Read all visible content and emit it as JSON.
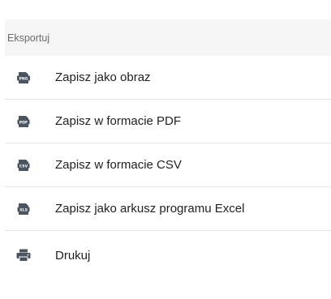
{
  "menu": {
    "header": "Eksportuj",
    "items": [
      {
        "label": "Zapisz jako obraz",
        "icon": "png-file-icon",
        "badge": "PNG"
      },
      {
        "label": "Zapisz w formacie PDF",
        "icon": "pdf-file-icon",
        "badge": "PDF"
      },
      {
        "label": "Zapisz w formacie CSV",
        "icon": "csv-file-icon",
        "badge": "CSV"
      },
      {
        "label": "Zapisz jako arkusz programu Excel",
        "icon": "xls-file-icon",
        "badge": "XLS"
      },
      {
        "label": "Drukuj",
        "icon": "printer-icon"
      }
    ]
  },
  "colors": {
    "icon": "#4a5560",
    "header_bg": "#f5f5f5",
    "divider": "#e6e6e6"
  }
}
